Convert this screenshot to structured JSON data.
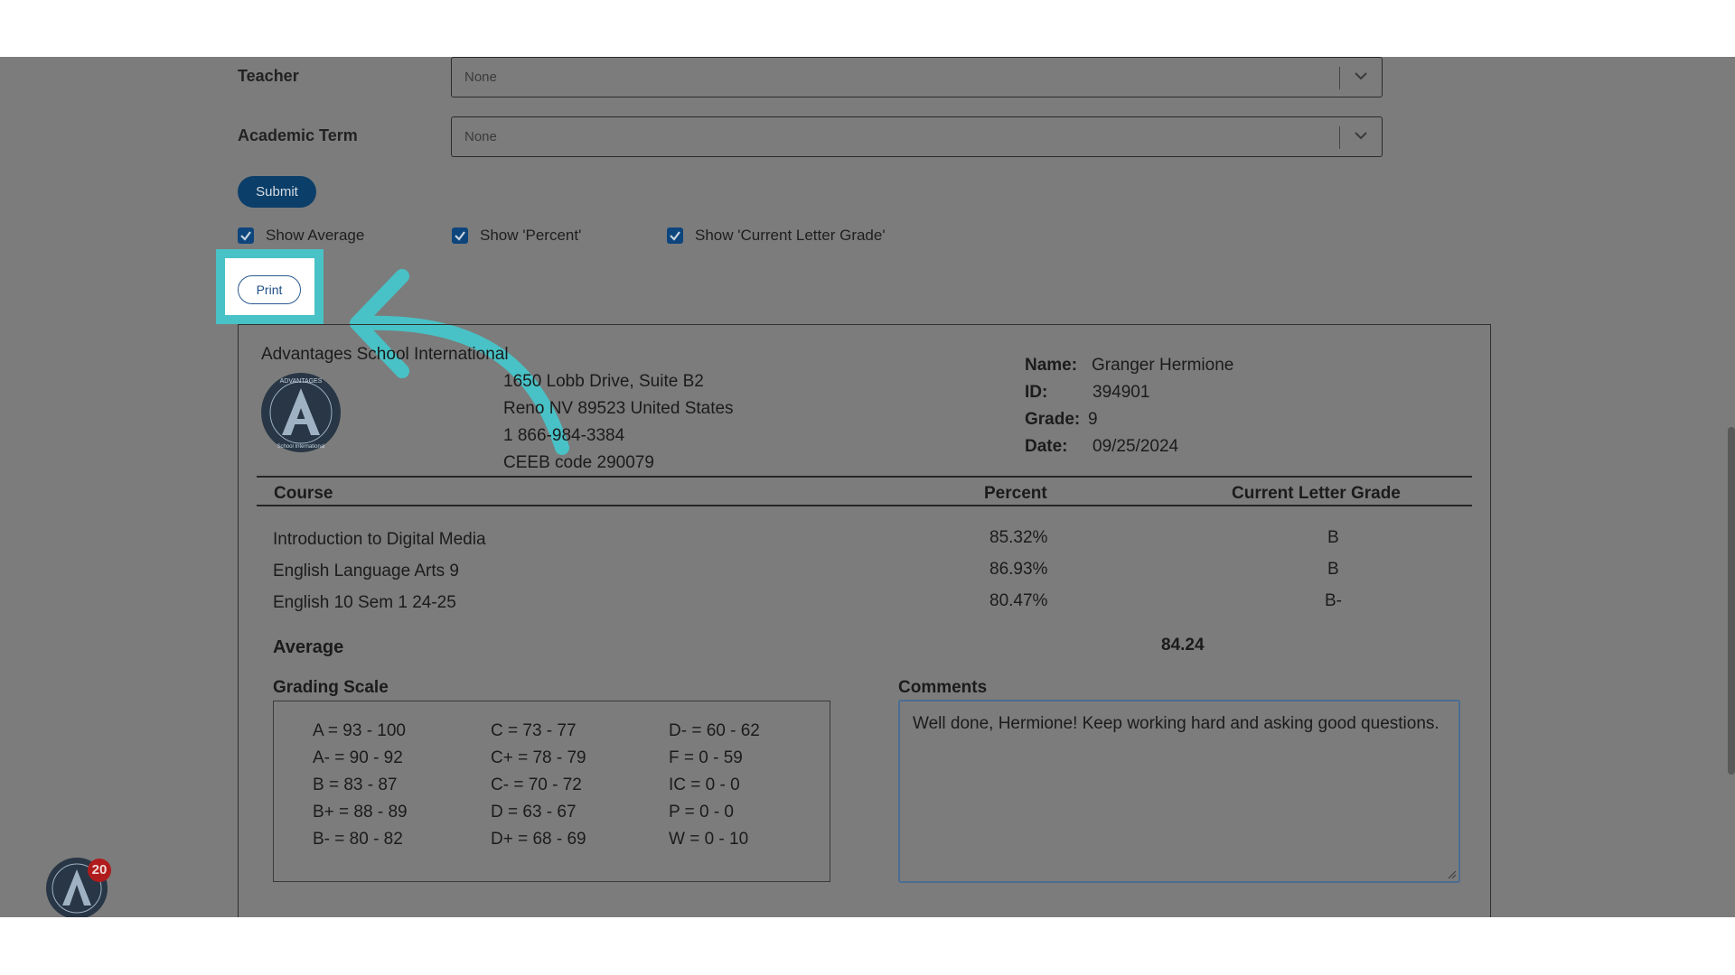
{
  "filters": {
    "teacher": {
      "label": "Teacher",
      "value": "None"
    },
    "academic_term": {
      "label": "Academic Term",
      "value": "None"
    },
    "submit_label": "Submit"
  },
  "options": [
    {
      "label": "Show Average",
      "checked": true
    },
    {
      "label": "Show 'Percent'",
      "checked": true
    },
    {
      "label": "Show 'Current Letter Grade'",
      "checked": true
    }
  ],
  "print_label": "Print",
  "report": {
    "school_name": "Advantages School International",
    "logo_text": "ADVANTAGES",
    "logo_subtext": "School International",
    "address_lines": [
      "1650 Lobb Drive, Suite B2",
      "Reno NV 89523 United States",
      "1 866-984-3384",
      "CEEB code 290079"
    ],
    "student": {
      "name_label": "Name:",
      "name": "Granger Hermione",
      "id_label": "ID:",
      "id": "394901",
      "grade_label": "Grade:",
      "grade": "9",
      "date_label": "Date:",
      "date": "09/25/2024"
    },
    "table": {
      "headers": {
        "course": "Course",
        "percent": "Percent",
        "letter": "Current Letter Grade"
      },
      "rows": [
        {
          "course": "Introduction to Digital Media",
          "percent": "85.32%",
          "letter": "B"
        },
        {
          "course": "English Language Arts 9",
          "percent": "86.93%",
          "letter": "B"
        },
        {
          "course": "English 10 Sem 1 24-25",
          "percent": "80.47%",
          "letter": "B-"
        }
      ]
    },
    "average_label": "Average",
    "average_value": "84.24",
    "grading_scale_title": "Grading Scale",
    "grading_scale": [
      [
        "A = 93 - 100",
        "A- = 90 - 92",
        "B = 83 - 87",
        "B+ = 88 - 89",
        "B- = 80 - 82"
      ],
      [
        "C = 73 - 77",
        "C+ = 78 - 79",
        "C- = 70 - 72",
        "D = 63 - 67",
        "D+ = 68 - 69"
      ],
      [
        "D- = 60 - 62",
        "F = 0 - 59",
        "IC = 0 - 0",
        "P = 0 - 0",
        "W = 0 - 10"
      ]
    ],
    "comments_title": "Comments",
    "comments_text": "Well done, Hermione! Keep working hard and asking good questions."
  },
  "chat": {
    "badge_count": "20"
  },
  "colors": {
    "overlay": "#7c7c7c",
    "highlight": "#48c2c6",
    "submit_bg": "#0b3e69",
    "checkbox": "#0d457c",
    "badge": "#b01b1b"
  }
}
